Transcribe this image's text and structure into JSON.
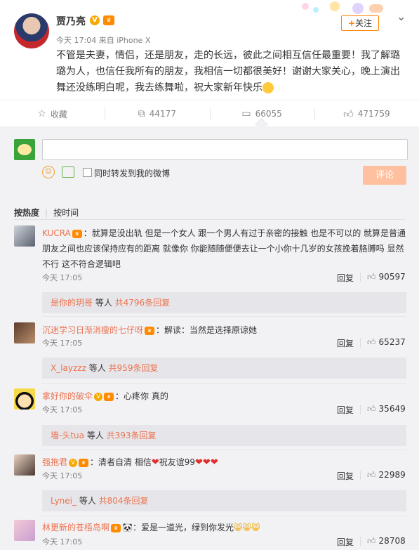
{
  "post": {
    "author": "贾乃亮",
    "time": "今天 17:04",
    "source": "来自 iPhone X",
    "follow_label": "关注",
    "content": "不管是夫妻，情侣，还是朋友，走的长远，彼此之间相互信任最重要！我了解璐璐为人，也信任我所有的朋友，我相信一切都很美好！谢谢大家关心，晚上演出舞还没练明白呢，我去练舞啦，祝大家新年快乐"
  },
  "actions": {
    "favorite": "收藏",
    "repost": "44177",
    "comment": "66055",
    "like": "471759"
  },
  "composer": {
    "placeholder": "",
    "repost_checkbox_label": "同时转发到我的微博",
    "submit_label": "评论"
  },
  "tabs": {
    "hot": "按热度",
    "time": "按时间"
  },
  "comments": [
    {
      "user": "KUCRA",
      "text": "：就算是没出轨 但是一个女人 跟一个男人有过于亲密的接触 也是不可以的 就算是普通朋友之间也应该保持应有的距离 就像你 你能随随便便去让一个小你十几岁的女孩挽着胳膊吗 显然不行 这不符合逻辑吧",
      "time": "今天 17:05",
      "reply": "回复",
      "likes": "90597",
      "sub_user": "是你的玥哥",
      "sub_mid": " 等人 ",
      "sub_count": "共4796条回复"
    },
    {
      "user": "沉迷学习日渐消瘦的七仔呀",
      "text": "：解读：当然是选择原谅她",
      "time": "今天 17:05",
      "reply": "回复",
      "likes": "65237",
      "sub_user": "X_layzzz",
      "sub_mid": " 等人 ",
      "sub_count": "共959条回复"
    },
    {
      "user": "拿好你的破伞",
      "text": "：心疼你 真的",
      "time": "今天 17:05",
      "reply": "回复",
      "likes": "35649",
      "sub_user": "墙-头tua",
      "sub_mid": " 等人 ",
      "sub_count": "共393条回复"
    },
    {
      "user": "强抱君",
      "text": "：清者自清 相信",
      "text2": "祝友谊99",
      "time": "今天 17:05",
      "reply": "回复",
      "likes": "22989",
      "sub_user": "Lynei_",
      "sub_mid": " 等人 ",
      "sub_count": "共804条回复"
    },
    {
      "user": "林更新的苍梧岛啊",
      "text": "：爱是一道光，绿到你发光",
      "time": "今天 17:05",
      "reply": "回复",
      "likes": "28708"
    }
  ]
}
